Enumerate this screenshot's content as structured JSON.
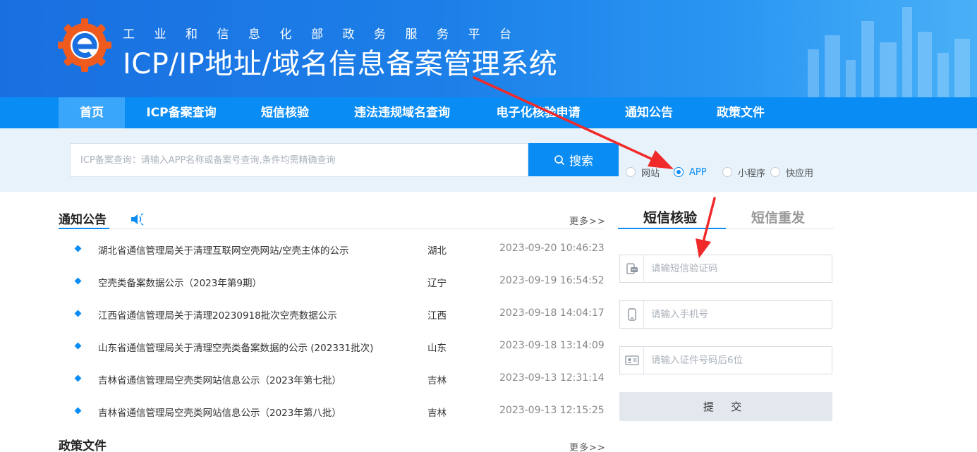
{
  "header": {
    "subtitle": "工业和信息化部政务服务平台",
    "title": "ICP/IP地址/域名信息备案管理系统"
  },
  "nav": {
    "items": [
      {
        "label": "首页",
        "active": true
      },
      {
        "label": "ICP备案查询"
      },
      {
        "label": "短信核验"
      },
      {
        "label": "违法违规域名查询"
      },
      {
        "label": "电子化核验申请"
      },
      {
        "label": "通知公告"
      },
      {
        "label": "政策文件"
      }
    ]
  },
  "search": {
    "placeholder": "ICP备案查询：请输入APP名称或备案号查询,条件均需精确查询",
    "button_label": "搜索",
    "options": [
      {
        "label": "网站",
        "checked": false
      },
      {
        "label": "APP",
        "checked": true
      },
      {
        "label": "小程序",
        "checked": false
      },
      {
        "label": "快应用",
        "checked": false
      }
    ]
  },
  "notices": {
    "title": "通知公告",
    "more": "更多>>",
    "items": [
      {
        "title": "湖北省通信管理局关于清理互联网空壳网站/空壳主体的公示",
        "province": "湖北",
        "date": "2023-09-20 10:46:23"
      },
      {
        "title": "空壳类备案数据公示（2023年第9期）",
        "province": "辽宁",
        "date": "2023-09-19 16:54:52"
      },
      {
        "title": "江西省通信管理局关于清理20230918批次空壳数据公示",
        "province": "江西",
        "date": "2023-09-18 14:04:17"
      },
      {
        "title": "山东省通信管理局关于清理空壳类备案数据的公示 (202331批次)",
        "province": "山东",
        "date": "2023-09-18 13:14:09"
      },
      {
        "title": "吉林省通信管理局空壳类网站信息公示（2023年第七批）",
        "province": "吉林",
        "date": "2023-09-13 12:31:14"
      },
      {
        "title": "吉林省通信管理局空壳类网站信息公示（2023年第八批）",
        "province": "吉林",
        "date": "2023-09-13 12:15:25"
      }
    ]
  },
  "policy": {
    "title": "政策文件",
    "more": "更多>>"
  },
  "sms": {
    "tabs": [
      {
        "label": "短信核验",
        "active": true
      },
      {
        "label": "短信重发",
        "active": false
      }
    ],
    "code_placeholder": "请输短信验证码",
    "phone_placeholder": "请输入手机号",
    "id_placeholder": "请输入证件号码后6位",
    "submit_label": "提 交"
  },
  "colors": {
    "accent": "#0a8cf5",
    "annotation_arrow": "#f02a2a"
  },
  "icons": {
    "logo": "gear-e-logo",
    "speaker": "speaker-icon",
    "search": "search-icon",
    "sms": "sms-message-icon",
    "phone": "mobile-phone-icon",
    "id": "id-card-icon"
  }
}
